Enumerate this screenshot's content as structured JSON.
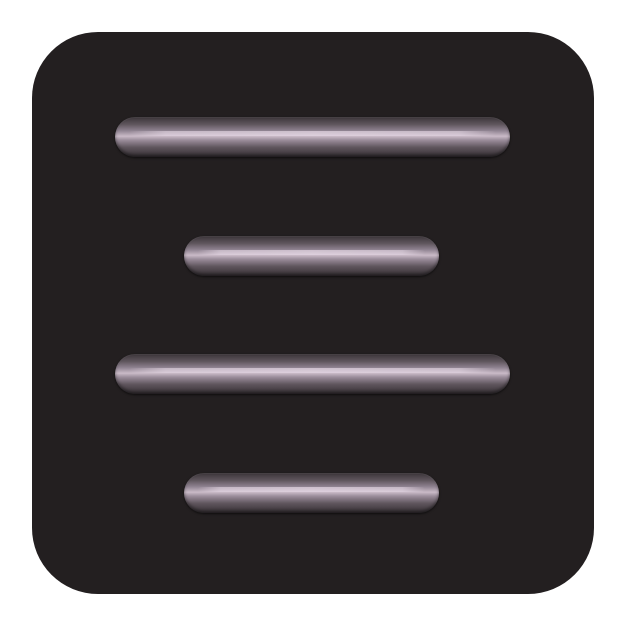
{
  "icon": {
    "name": "align-center-icon",
    "tile_color": "#231f20",
    "bar_highlight_color": "#c9bac7",
    "bars": [
      {
        "name": "bar-long-1",
        "size": "long"
      },
      {
        "name": "bar-short-1",
        "size": "short"
      },
      {
        "name": "bar-long-2",
        "size": "long"
      },
      {
        "name": "bar-short-2",
        "size": "short"
      }
    ]
  }
}
